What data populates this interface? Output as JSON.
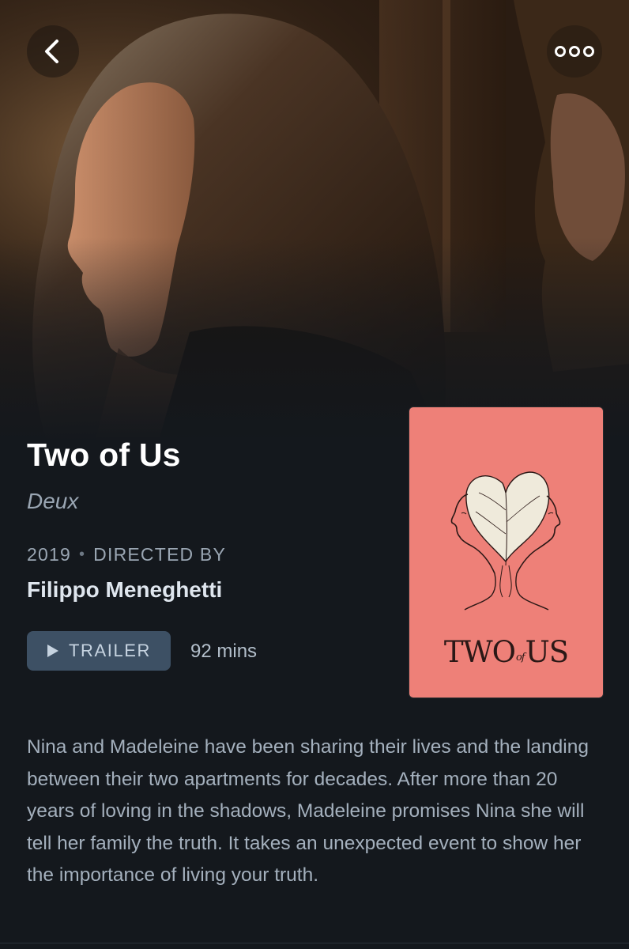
{
  "nav": {
    "back_icon": "chevron-left-icon",
    "more_icon": "ellipsis-icon"
  },
  "film": {
    "title": "Two of Us",
    "original_title": "Deux",
    "year": "2019",
    "directed_by_label": "DIRECTED BY",
    "director": "Filippo Meneghetti",
    "trailer_label": "TRAILER",
    "runtime": "92 mins",
    "synopsis": "Nina and Madeleine have been sharing their lives and the landing between their two apartments for decades. After more than 20 years of loving in the shadows, Madeleine promises Nina she will tell her family the truth. It takes an unexpected event to show her the importance of living your truth."
  },
  "poster": {
    "title_part1": "TWO",
    "title_part2": "of",
    "title_part3": "US",
    "background": "#ee8078"
  },
  "colors": {
    "page_background": "#14181d",
    "trailer_button": "#3d5064",
    "muted_text": "#9aa6b3"
  }
}
